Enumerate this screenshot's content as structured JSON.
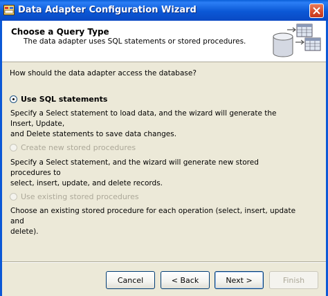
{
  "window": {
    "title": "Data Adapter Configuration Wizard"
  },
  "header": {
    "title": "Choose a Query Type",
    "subtitle": "The data adapter uses SQL statements or stored procedures."
  },
  "body": {
    "question": "How should the data adapter access the database?",
    "options": [
      {
        "label": "Use SQL statements",
        "description_lines": [
          "Specify a Select statement to load data, and the wizard will generate the Insert, Update,",
          "and Delete statements to save data changes."
        ],
        "selected": true,
        "enabled": true
      },
      {
        "label": "Create new stored procedures",
        "description_lines": [
          "Specify a Select statement, and the wizard will generate new stored procedures to",
          "select, insert, update, and delete records."
        ],
        "selected": false,
        "enabled": false
      },
      {
        "label": "Use existing stored procedures",
        "description_lines": [
          "Choose an existing stored procedure for each operation (select, insert, update and",
          "delete)."
        ],
        "selected": false,
        "enabled": false
      }
    ]
  },
  "footer": {
    "cancel": "Cancel",
    "back": "< Back",
    "next": "Next >",
    "finish": "Finish"
  },
  "icons": {
    "app": "data-adapter-icon",
    "close": "close-icon",
    "header_art": "database-table-icon"
  },
  "colors": {
    "titlebar": "#0b58d6",
    "dialog_bg": "#ece9d8",
    "disabled_text": "#aca899",
    "close": "#d64a2a"
  }
}
